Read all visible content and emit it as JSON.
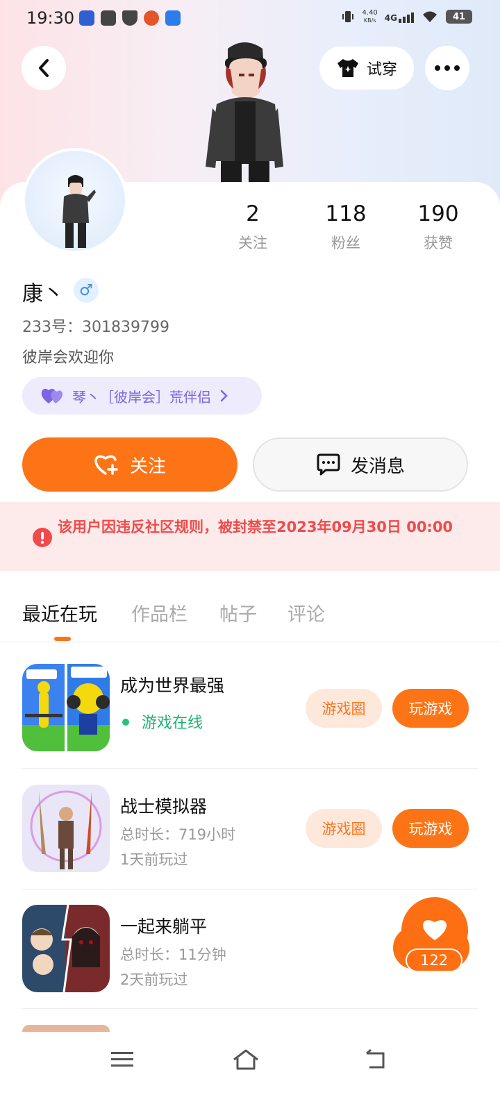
{
  "status_bar": {
    "time": "19:30",
    "net_speed_value": "4.40",
    "net_speed_unit": "KB/s",
    "network": "4G",
    "battery": "41"
  },
  "header": {
    "tryon_label": "试穿"
  },
  "profile": {
    "stats": [
      {
        "value": "2",
        "label": "关注"
      },
      {
        "value": "118",
        "label": "粉丝"
      },
      {
        "value": "190",
        "label": "获赞"
      }
    ],
    "name": "康丶",
    "gender": "♂",
    "uid": "233号：301839799",
    "bio": "彼岸会欢迎你",
    "partner": "琴丶［彼岸会］荒伴侣"
  },
  "actions": {
    "follow_label": "关注",
    "message_label": "发消息"
  },
  "ban_notice": "该用户因违反社区规则，被封禁至2023年09月30日 00:00",
  "tabs": [
    "最近在玩",
    "作品栏",
    "帖子",
    "评论"
  ],
  "games": [
    {
      "title": "成为世界最强",
      "status": "游戏在线",
      "circle_label": "游戏圈",
      "play_label": "玩游戏"
    },
    {
      "title": "战士模拟器",
      "duration": "总时长：719小时",
      "last_played": "1天前玩过",
      "circle_label": "游戏圈",
      "play_label": "玩游戏"
    },
    {
      "title": "一起来躺平",
      "duration": "总时长：11分钟",
      "last_played": "2天前玩过"
    }
  ],
  "likes_fab": {
    "count": "122"
  },
  "colors": {
    "accent": "#fd7417",
    "online": "#20b372",
    "ban": "#ef4b4b",
    "partner": "#7d64e3"
  }
}
